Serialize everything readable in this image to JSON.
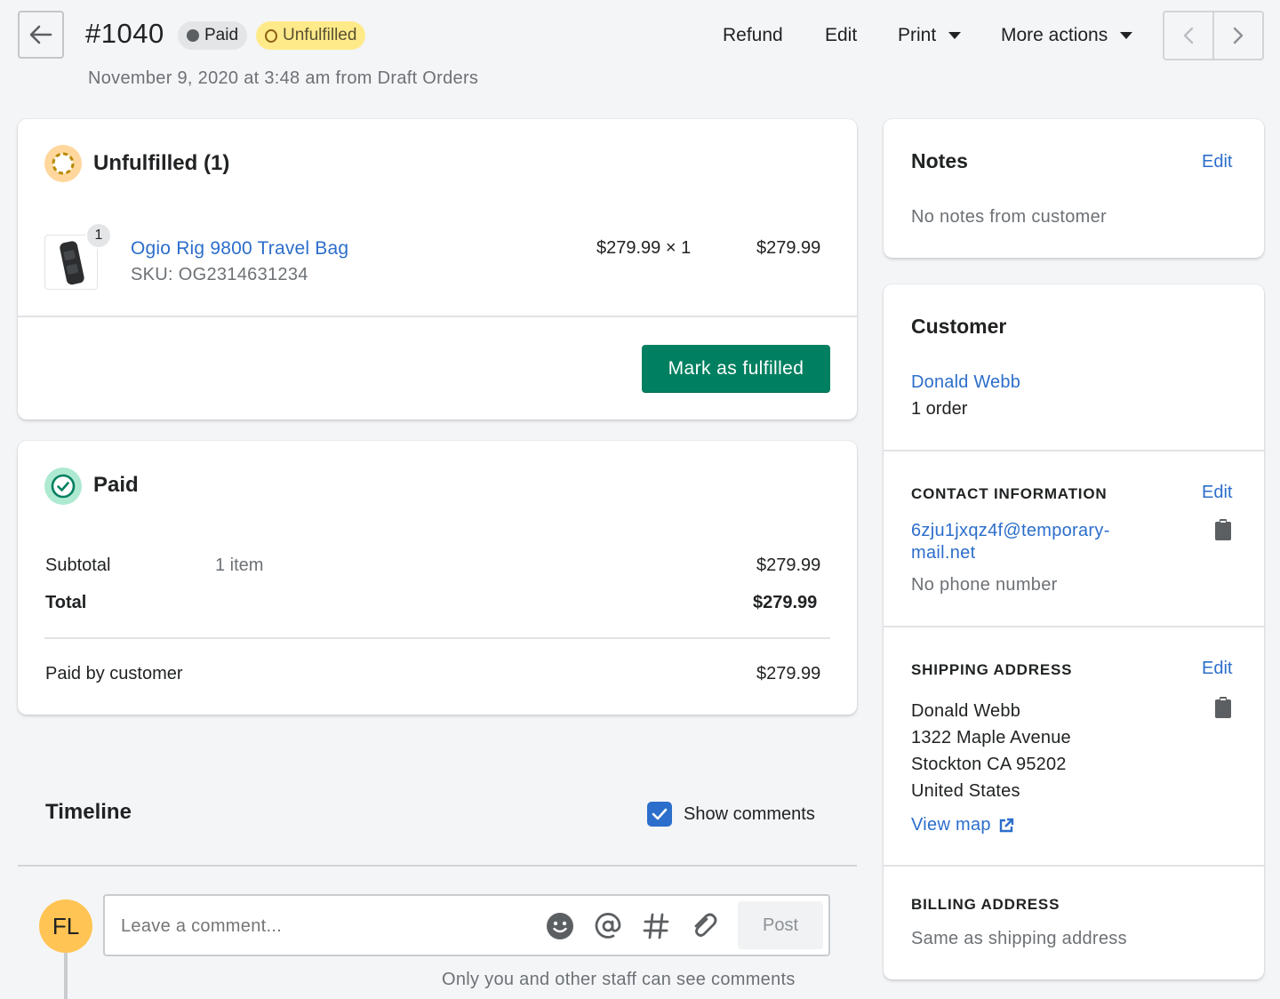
{
  "header": {
    "order_number": "#1040",
    "badge_paid": "Paid",
    "badge_unfulfilled": "Unfulfilled",
    "subtitle": "November 9, 2020 at 3:48 am from Draft Orders",
    "actions": {
      "refund": "Refund",
      "edit": "Edit",
      "print": "Print",
      "more": "More actions"
    }
  },
  "unfulfilled": {
    "title": "Unfulfilled (1)",
    "item": {
      "quantity_badge": "1",
      "name": "Ogio Rig 9800 Travel Bag",
      "sku": "SKU: OG2314631234",
      "unit_price": "$279.99 × 1",
      "line_total": "$279.99"
    },
    "mark_fulfilled_label": "Mark as fulfilled"
  },
  "payment": {
    "title": "Paid",
    "subtotal_label": "Subtotal",
    "subtotal_items": "1 item",
    "subtotal_value": "$279.99",
    "total_label": "Total",
    "total_value": "$279.99",
    "paid_by_label": "Paid by customer",
    "paid_by_value": "$279.99"
  },
  "timeline": {
    "title": "Timeline",
    "show_comments_label": "Show comments",
    "show_comments_checked": true,
    "avatar_initials": "FL",
    "comment_placeholder": "Leave a comment...",
    "post_label": "Post",
    "staff_note": "Only you and other staff can see comments"
  },
  "notes": {
    "title": "Notes",
    "edit_label": "Edit",
    "body": "No notes from customer"
  },
  "customer": {
    "title": "Customer",
    "name": "Donald Webb",
    "orders": "1 order",
    "contact": {
      "heading": "CONTACT INFORMATION",
      "edit_label": "Edit",
      "email_line1": "6zju1jxqz4f@temporary-",
      "email_line2": "mail.net",
      "phone": "No phone number"
    },
    "shipping": {
      "heading": "SHIPPING ADDRESS",
      "edit_label": "Edit",
      "line1": "Donald Webb",
      "line2": "1322 Maple Avenue",
      "line3": "Stockton CA 95202",
      "line4": "United States",
      "view_map": "View map"
    },
    "billing": {
      "heading": "BILLING ADDRESS",
      "body": "Same as shipping address"
    }
  },
  "colors": {
    "primary_green": "#008060",
    "link_blue": "#2c6ecb",
    "unfulfilled_badge": "#ffea8a",
    "paid_badge": "#e4e5e7",
    "avatar": "#ffc453"
  }
}
